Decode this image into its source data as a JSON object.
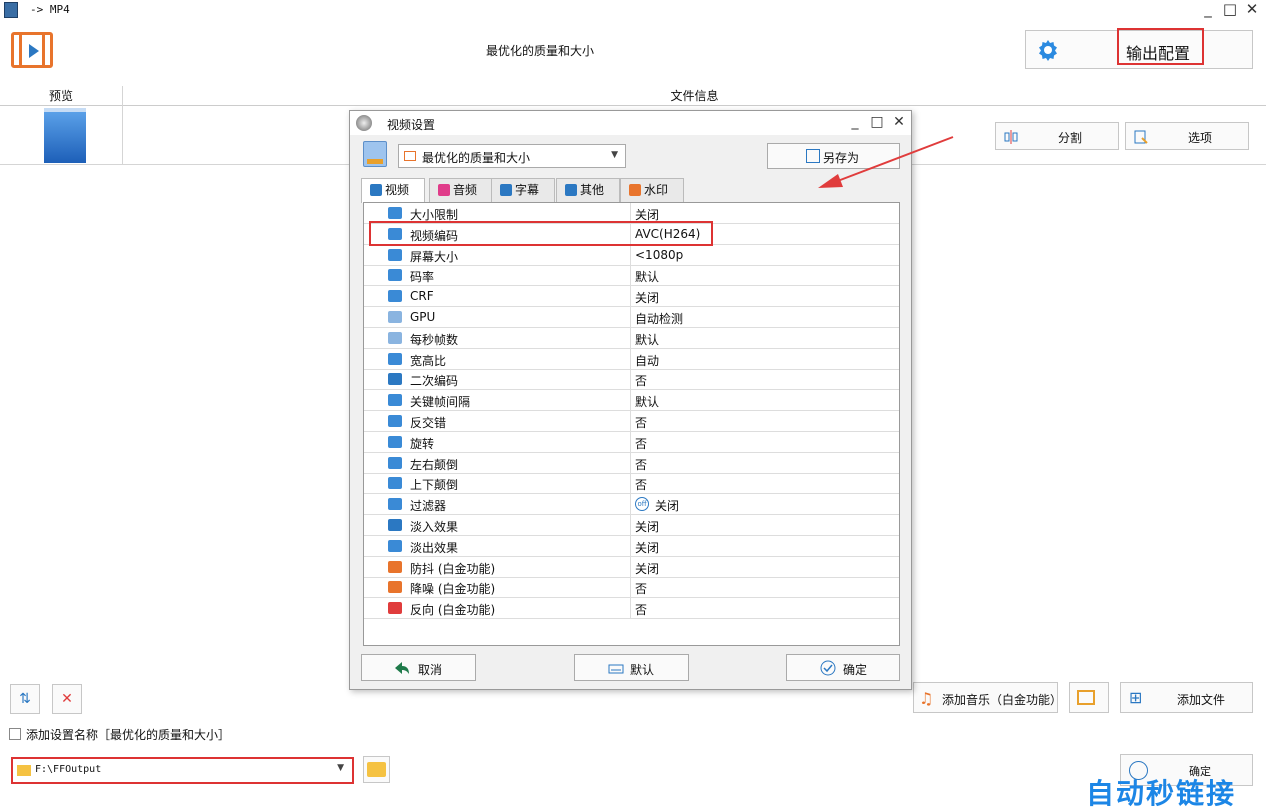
{
  "window": {
    "title": "-> MP4",
    "minimize": "_",
    "maximize": "□",
    "close": "✕"
  },
  "header": {
    "profile_title": "最优化的质量和大小",
    "output_config_label": "输出配置"
  },
  "file_list": {
    "col_preview": "预览",
    "col_info": "文件信息",
    "split_label": "分割",
    "options_label": "选项"
  },
  "bottom": {
    "add_setting_name_label": "添加设置名称［最优化的质量和大小］",
    "output_path": "F:\\FFOutput",
    "add_music_label": "添加音乐（白金功能）",
    "add_file_label": "添加文件",
    "ok_label": "确定",
    "watermark": "自动秒链接"
  },
  "dialog": {
    "title": "视频设置",
    "minimize": "_",
    "maximize": "□",
    "close": "✕",
    "preset": "最优化的质量和大小",
    "save_as_label": "另存为",
    "tabs": [
      {
        "label": "视频",
        "color": "#2b78c2"
      },
      {
        "label": "音频",
        "color": "#e03c8a"
      },
      {
        "label": "字幕",
        "color": "#2b78c2"
      },
      {
        "label": "其他",
        "color": "#2b78c2"
      },
      {
        "label": "水印",
        "color": "#e8742c"
      }
    ],
    "rows": [
      {
        "name": "大小限制",
        "value": "关闭",
        "icon": "size-limit-icon",
        "color": "#3a8ad6"
      },
      {
        "name": "视频编码",
        "value": "AVC(H264)",
        "icon": "video-codec-icon",
        "color": "#3a8ad6"
      },
      {
        "name": "屏幕大小",
        "value": "<1080p",
        "icon": "screen-size-icon",
        "color": "#3a8ad6"
      },
      {
        "name": "码率",
        "value": "默认",
        "icon": "bitrate-icon",
        "color": "#3a8ad6"
      },
      {
        "name": "CRF",
        "value": "关闭",
        "icon": "crf-icon",
        "color": "#3a8ad6"
      },
      {
        "name": "GPU",
        "value": "自动检测",
        "icon": "gpu-icon",
        "color": "#8ab4e0"
      },
      {
        "name": "每秒帧数",
        "value": "默认",
        "icon": "fps-icon",
        "color": "#8ab4e0"
      },
      {
        "name": "宽高比",
        "value": "自动",
        "icon": "aspect-ratio-icon",
        "color": "#3a8ad6"
      },
      {
        "name": "二次编码",
        "value": "否",
        "icon": "two-pass-icon",
        "color": "#2b78c2"
      },
      {
        "name": "关键帧间隔",
        "value": "默认",
        "icon": "keyframe-interval-icon",
        "color": "#3a8ad6"
      },
      {
        "name": "反交错",
        "value": "否",
        "icon": "deinterlace-icon",
        "color": "#3a8ad6"
      },
      {
        "name": "旋转",
        "value": "否",
        "icon": "rotate-icon",
        "color": "#3a8ad6"
      },
      {
        "name": "左右颠倒",
        "value": "否",
        "icon": "flip-horizontal-icon",
        "color": "#3a8ad6"
      },
      {
        "name": "上下颠倒",
        "value": "否",
        "icon": "flip-vertical-icon",
        "color": "#3a8ad6"
      },
      {
        "name": "过滤器",
        "value": "关闭",
        "icon": "filter-icon",
        "color": "#3a8ad6",
        "value_prefix": "off"
      },
      {
        "name": "淡入效果",
        "value": "关闭",
        "icon": "fade-in-icon",
        "color": "#2b78c2"
      },
      {
        "name": "淡出效果",
        "value": "关闭",
        "icon": "fade-out-icon",
        "color": "#3a8ad6"
      },
      {
        "name": "防抖 (白金功能)",
        "value": "关闭",
        "icon": "stabilize-icon",
        "color": "#e8742c"
      },
      {
        "name": "降噪 (白金功能)",
        "value": "否",
        "icon": "denoise-icon",
        "color": "#e8742c"
      },
      {
        "name": "反向 (白金功能)",
        "value": "否",
        "icon": "reverse-icon",
        "color": "#e03c3c"
      }
    ],
    "cancel_label": "取消",
    "default_label": "默认",
    "ok_label": "确定"
  }
}
